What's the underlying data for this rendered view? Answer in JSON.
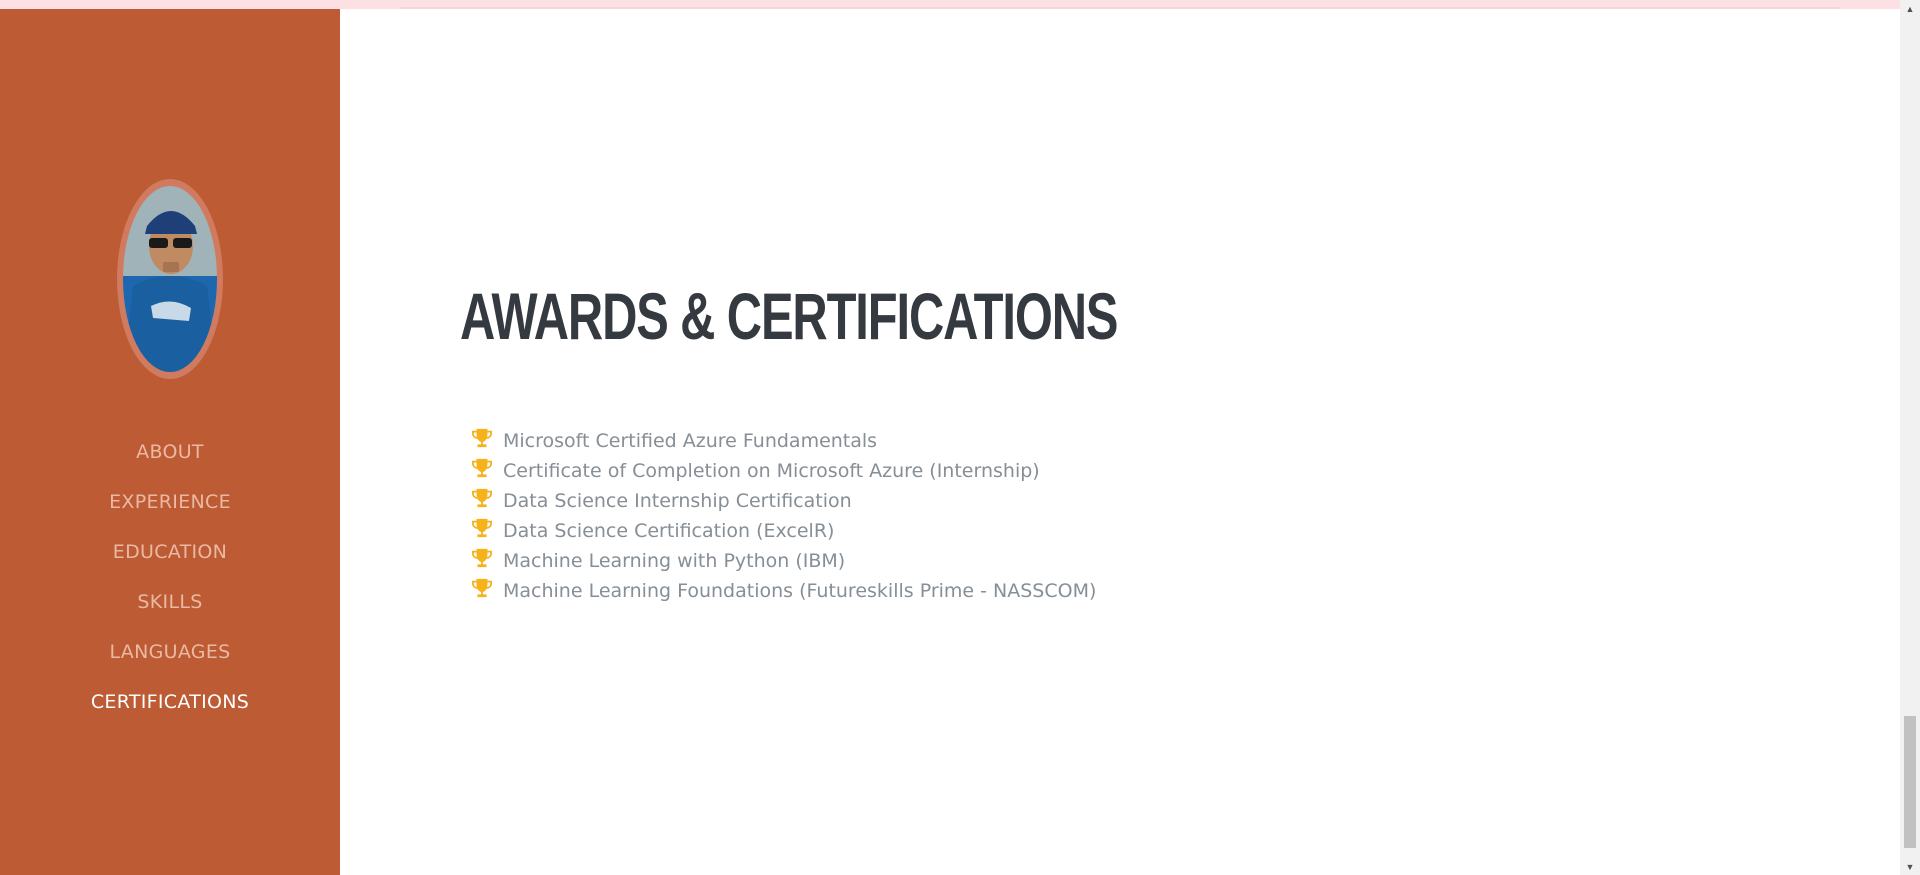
{
  "sidebar": {
    "avatar_alt": "Profile photo",
    "nav": [
      {
        "label": "About",
        "active": false
      },
      {
        "label": "Experience",
        "active": false
      },
      {
        "label": "Education",
        "active": false
      },
      {
        "label": "Skills",
        "active": false
      },
      {
        "label": "Languages",
        "active": false
      },
      {
        "label": "Certifications",
        "active": true
      }
    ],
    "colors": {
      "background": "#bc5b34",
      "nav_text": "#ebb9a3",
      "nav_active": "#ffffff"
    }
  },
  "main": {
    "heading": "Awards & Certifications",
    "list_icon": "trophy-icon",
    "icon_color": "#f6b21b",
    "items": [
      "Microsoft Certified Azure Fundamentals",
      "Certificate of Completion on Microsoft Azure (Internship)",
      "Data Science Internship Certification",
      "Data Science Certification (ExcelR)",
      "Machine Learning with Python (IBM)",
      "Machine Learning Foundations (Futureskills Prime - NASSCOM)"
    ]
  },
  "scrollbar": {
    "up_icon": "scroll-up-arrow-icon",
    "down_icon": "scroll-down-arrow-icon"
  }
}
